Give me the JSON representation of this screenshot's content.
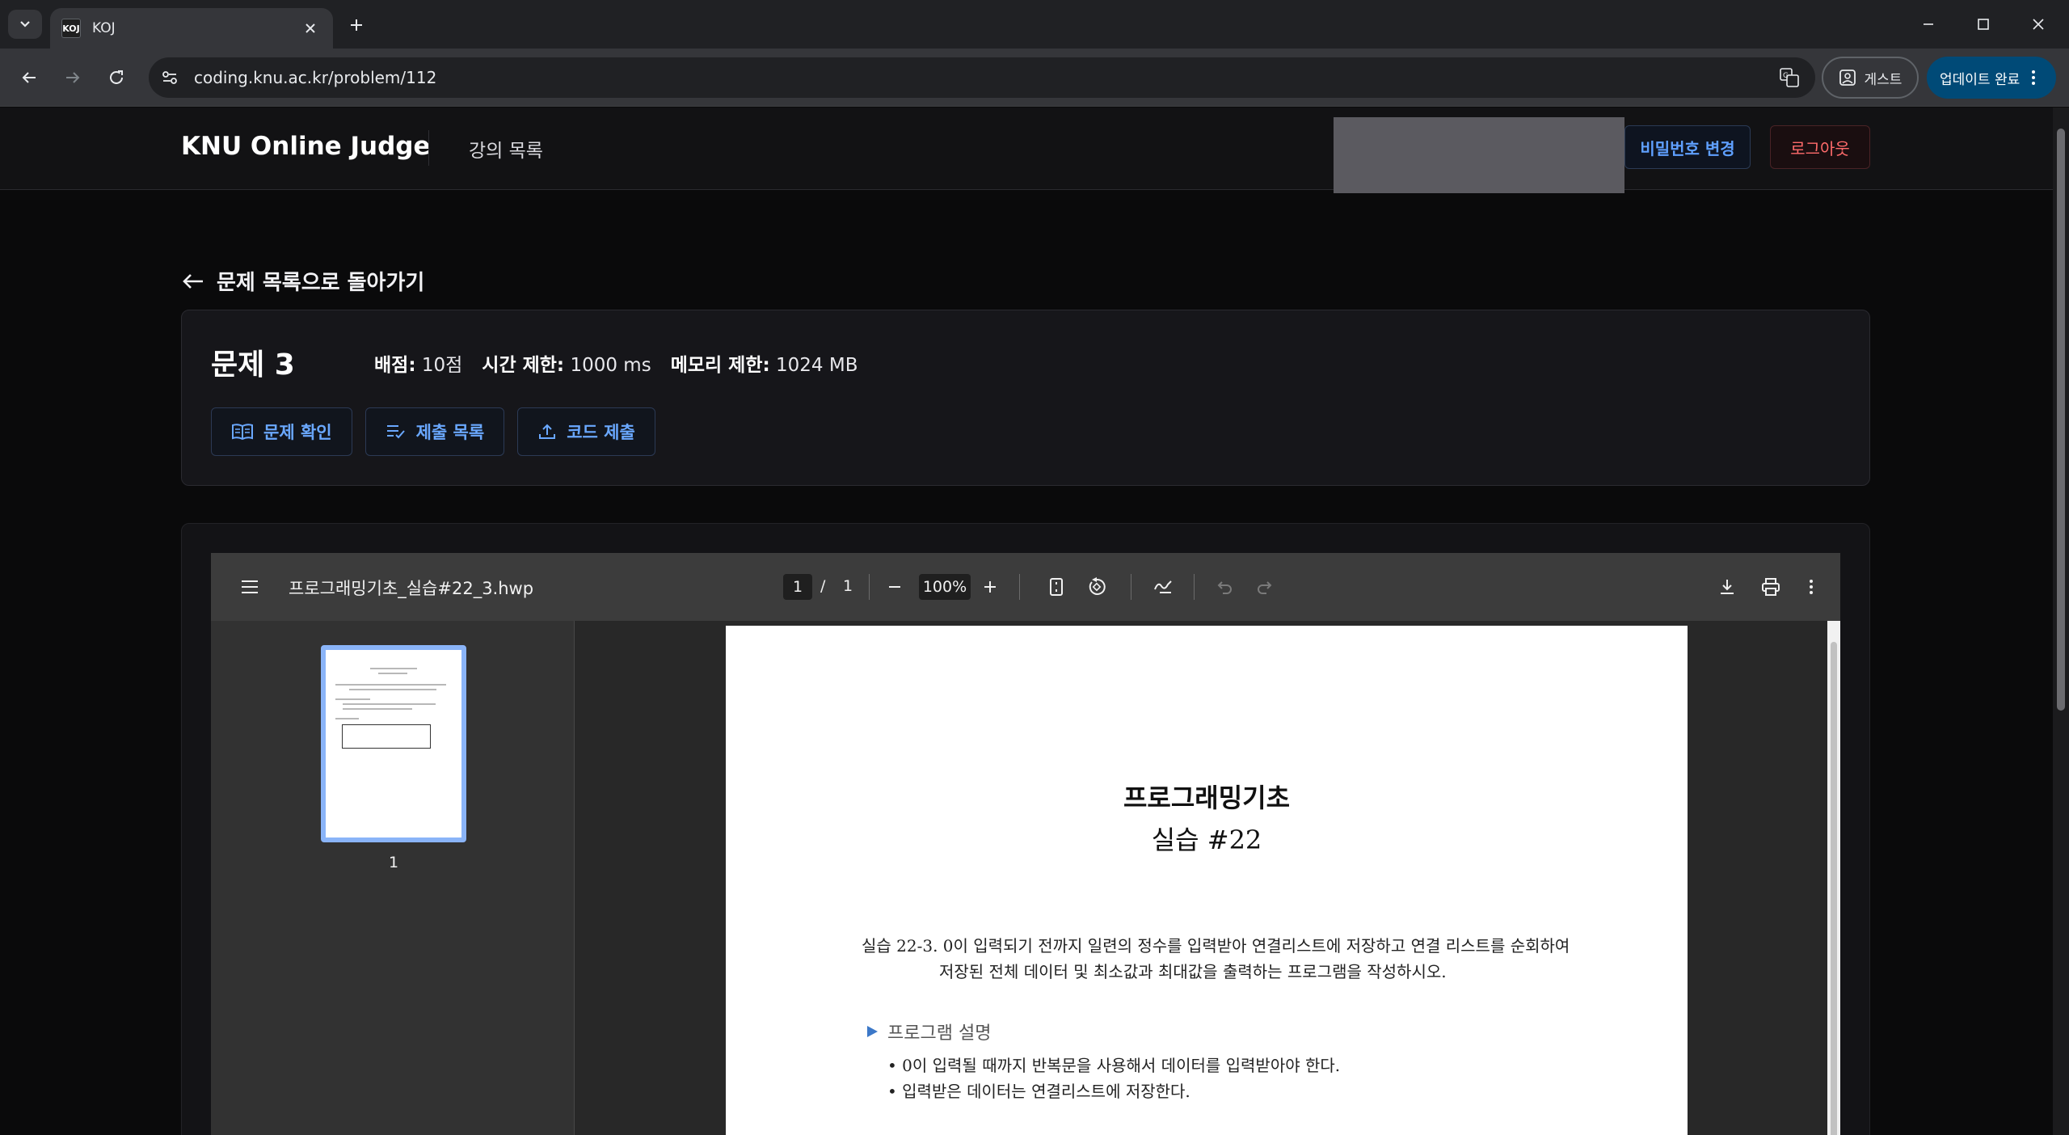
{
  "browser": {
    "tab_title": "KOJ",
    "favicon_text": "KOJ",
    "url": "coding.knu.ac.kr/problem/112",
    "profile_label": "게스트",
    "update_label": "업데이트 완료"
  },
  "header": {
    "brand": "KNU Online Judge",
    "nav_course": "강의 목록",
    "change_password": "비밀번호 변경",
    "logout": "로그아웃"
  },
  "back_link": "문제 목록으로 돌아가기",
  "problem": {
    "title": "문제 3",
    "score_label": "배점:",
    "score_value": "10점",
    "time_label": "시간 제한:",
    "time_value": "1000 ms",
    "memory_label": "메모리 제한:",
    "memory_value": "1024 MB",
    "buttons": {
      "view": "문제 확인",
      "submissions": "제출 목록",
      "submit": "코드 제출"
    }
  },
  "pdf": {
    "file_name": "프로그래밍기초_실습#22_3.hwp",
    "current_page": "1",
    "page_sep": "/",
    "total_pages": "1",
    "zoom": "100%",
    "thumb_number": "1",
    "doc": {
      "title_line1": "프로그래밍기초",
      "title_line2": "실습 #22",
      "para_line1": "실습 22-3. 0이 입력되기 전까지 일련의 정수를 입력받아 연결리스트에 저장하고 연결 리스트를 순회하여",
      "para_line2": "저장된 전체 데이터 및 최소값과 최대값을 출력하는 프로그램을 작성하시오.",
      "section": "프로그램 설명",
      "bullet1": "• 0이 입력될 때까지 반복문을 사용해서 데이터를 입력받아야 한다.",
      "bullet2": "• 입력받은 데이터는 연결리스트에 저장한다."
    }
  },
  "colors": {
    "accent_blue": "#5fa0ff",
    "logout_red": "#ff6b6b",
    "update_chip": "#004a77"
  }
}
